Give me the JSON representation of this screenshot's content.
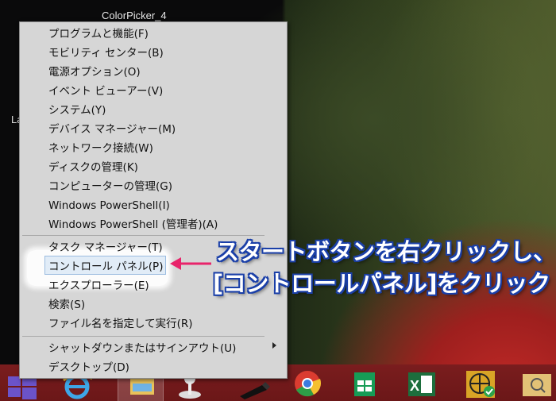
{
  "desktop": {
    "icon_label": "ColorPicker_4",
    "side_label": "La"
  },
  "menu": {
    "group1": [
      "プログラムと機能(F)",
      "モビリティ センター(B)",
      "電源オプション(O)",
      "イベント ビューアー(V)",
      "システム(Y)",
      "デバイス マネージャー(M)",
      "ネットワーク接続(W)",
      "ディスクの管理(K)",
      "コンピューターの管理(G)",
      "Windows PowerShell(I)",
      "Windows PowerShell (管理者)(A)"
    ],
    "group2": [
      "タスク マネージャー(T)",
      "コントロール パネル(P)",
      "エクスプローラー(E)",
      "検索(S)",
      "ファイル名を指定して実行(R)"
    ],
    "group3": [
      "シャットダウンまたはサインアウト(U)",
      "デスクトップ(D)"
    ],
    "highlighted_item": "コントロール パネル(P)"
  },
  "annotation": {
    "line1": "スタートボタンを右クリックし、",
    "line2": "[コントロールパネル]をクリック",
    "text_color": "#ffffff",
    "outline_color": "#1a3fa8",
    "arrow_color": "#e8246b"
  },
  "taskbar": {
    "background_color": "#6b1718",
    "icons": [
      "start-icon",
      "internet-explorer-icon",
      "file-explorer-icon",
      "maps-pin-icon",
      "pen-icon",
      "chrome-icon",
      "store-icon",
      "excel-icon",
      "network-globe-icon",
      "search-folder-icon"
    ]
  }
}
